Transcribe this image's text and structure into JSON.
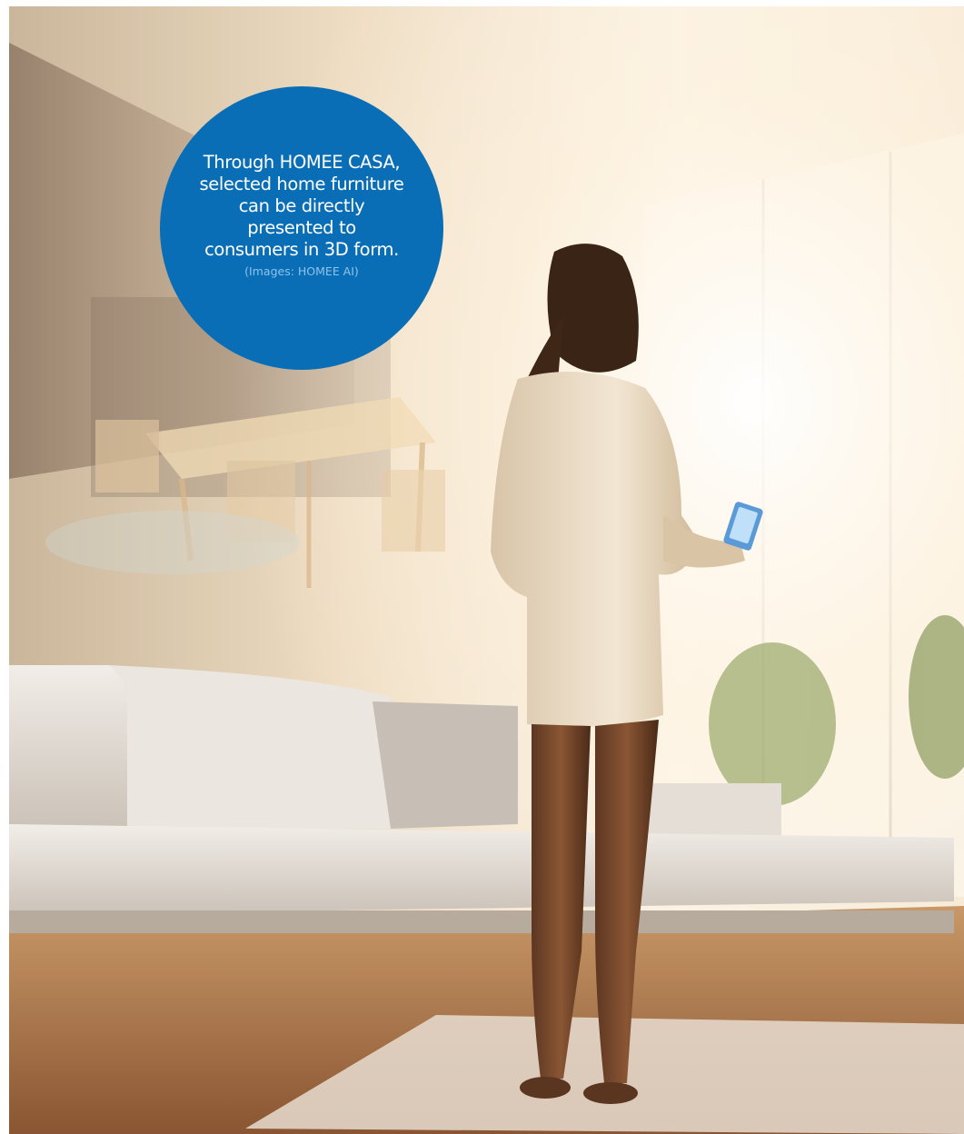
{
  "caption": {
    "main_text": "Through HOMEE CASA, selected home furniture can be directly presented to consumers in 3D form.",
    "credit": "(Images: HOMEE AI)",
    "circle_color": "#0a6eb6",
    "credit_color": "#8ec3ea"
  },
  "photo": {
    "subject": "woman holding smartphone in sunlit living room with sofa and holographic dining set",
    "palette": [
      "#f6e7d2",
      "#e7c79c",
      "#b07a4a",
      "#f4efe8",
      "#6b4a33"
    ]
  }
}
